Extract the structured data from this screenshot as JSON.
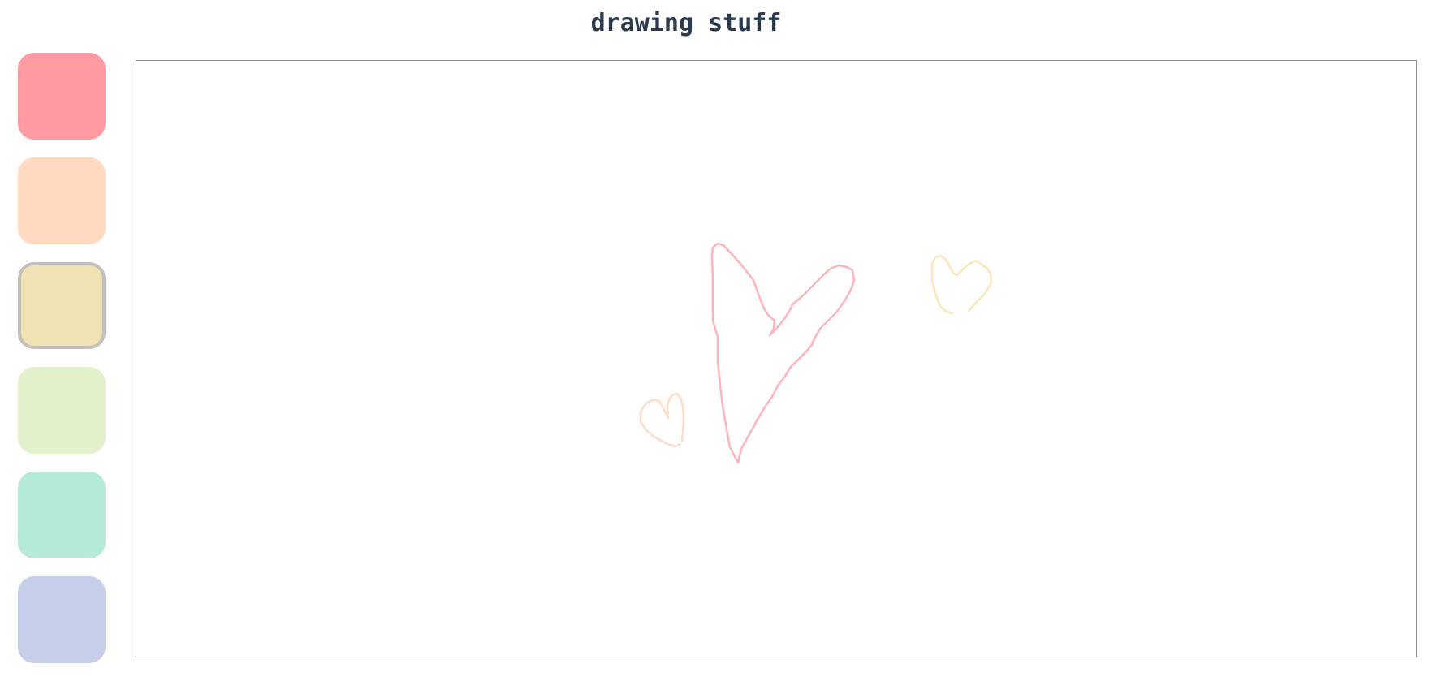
{
  "header": {
    "title": "drawing stuff"
  },
  "palette": {
    "selected_index": 2,
    "swatches": [
      {
        "name": "red",
        "color": "#ff9aa2"
      },
      {
        "name": "peach",
        "color": "#ffdac1"
      },
      {
        "name": "yellow",
        "color": "#f0e2b3"
      },
      {
        "name": "green",
        "color": "#e2f0cb"
      },
      {
        "name": "mint",
        "color": "#b5ead7"
      },
      {
        "name": "lavender",
        "color": "#c7ceea"
      }
    ]
  },
  "canvas": {
    "background": "#ffffff",
    "stroke_colors": {
      "big_heart": "#ffb3ba",
      "small_heart_left": "#ffdcc8",
      "small_heart_right": "#fbe6b8"
    }
  }
}
